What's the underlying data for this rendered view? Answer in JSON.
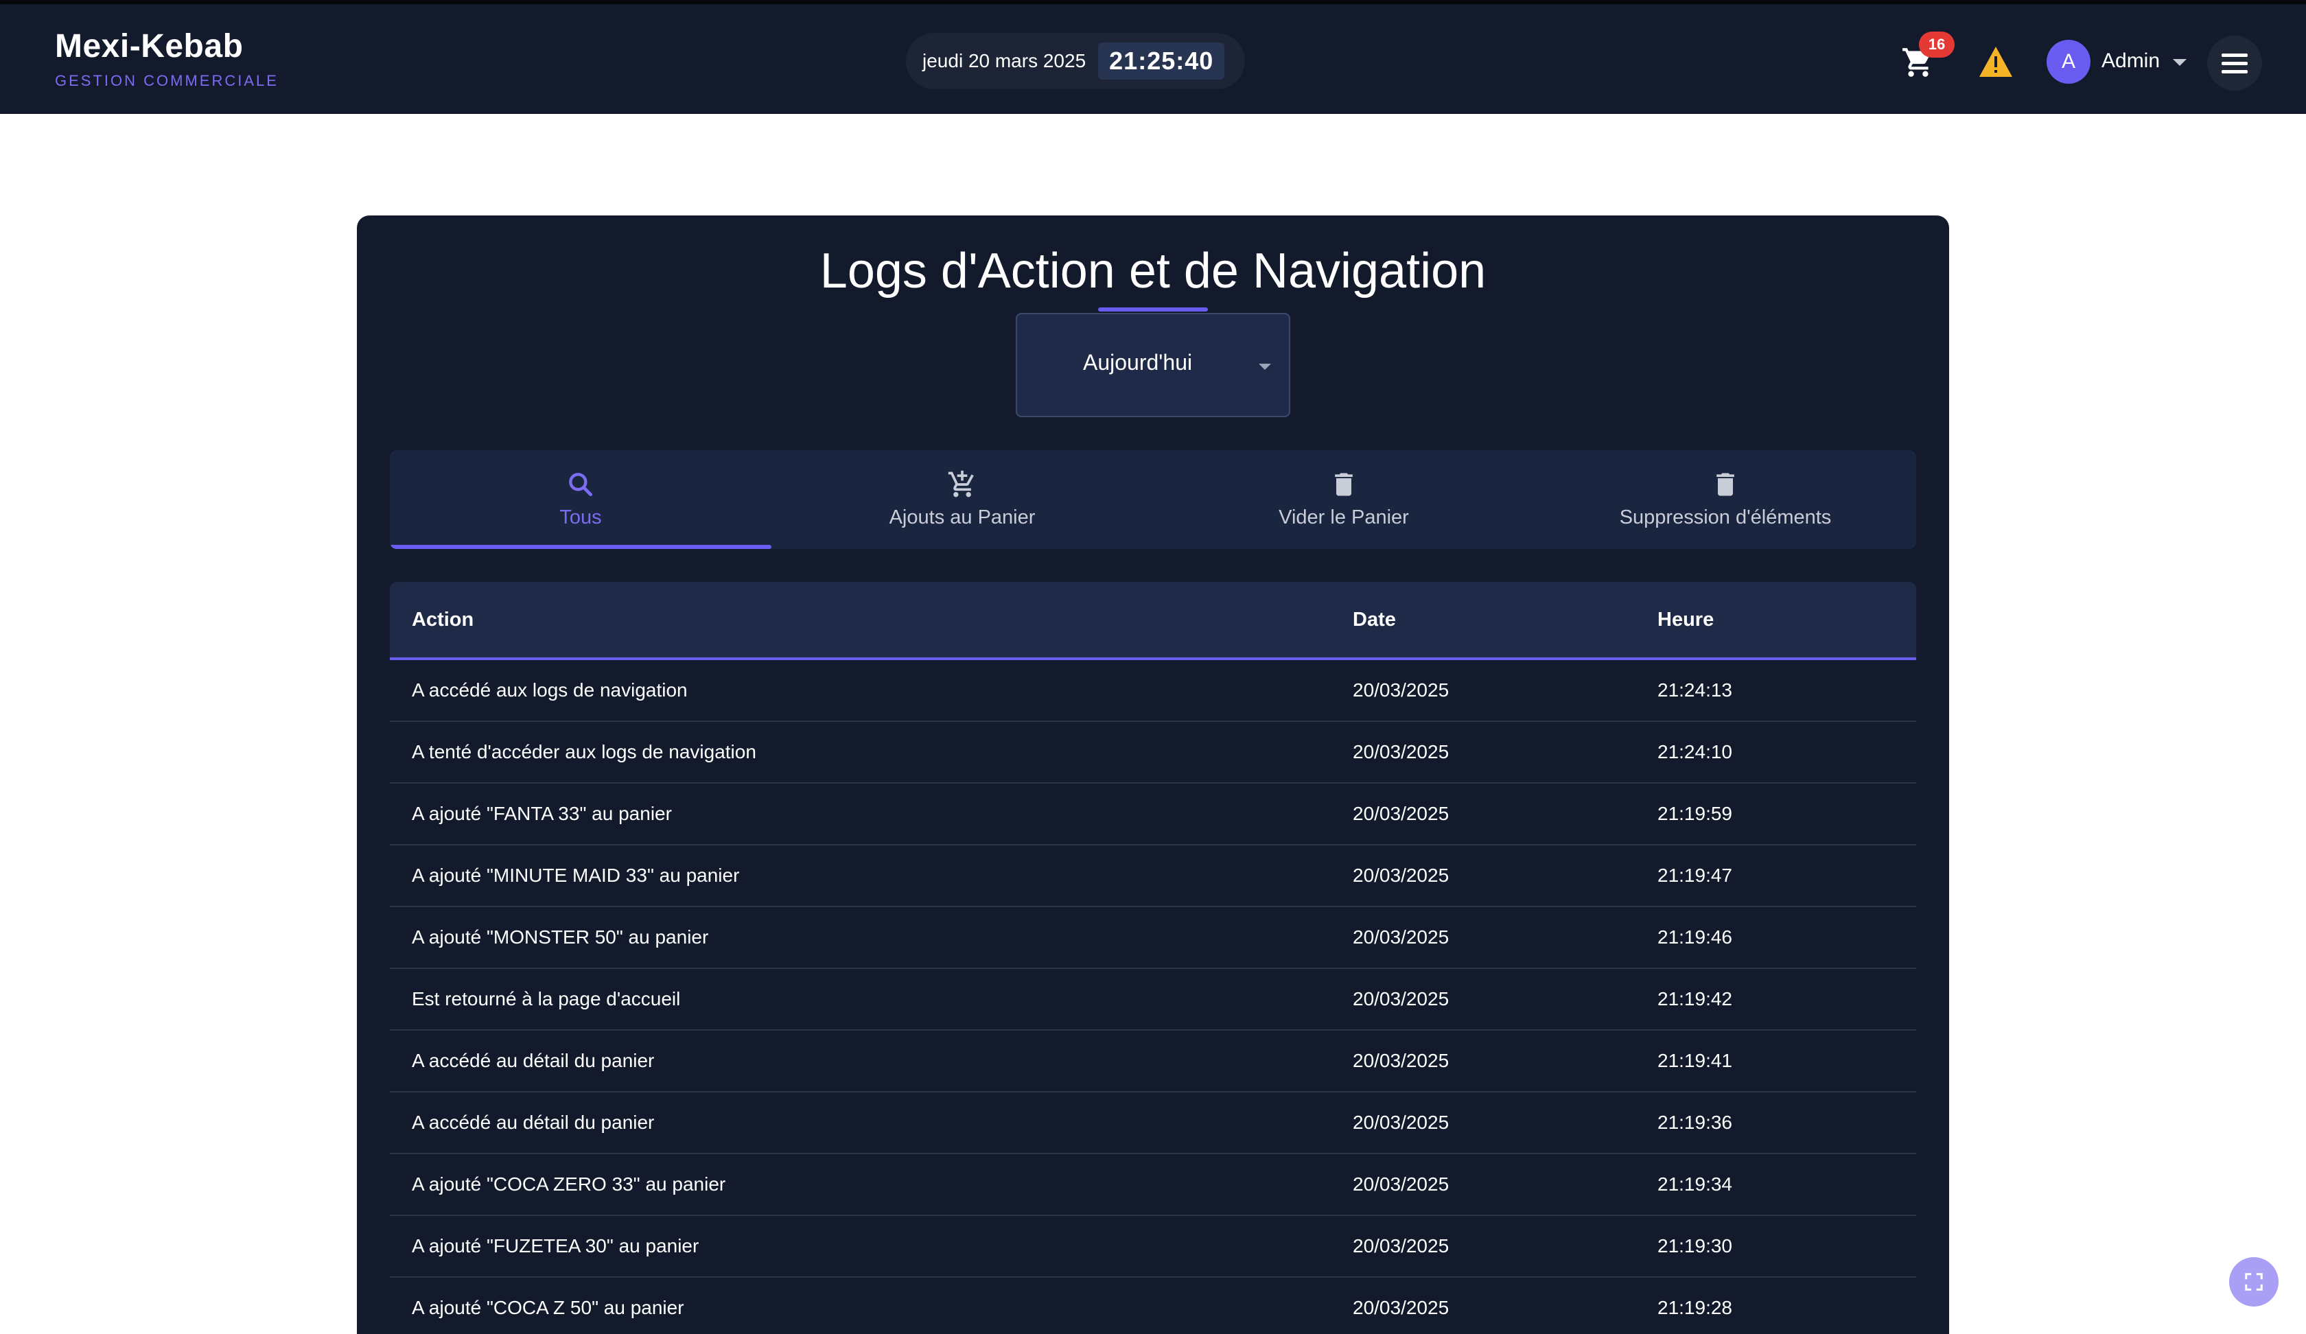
{
  "brand": {
    "name": "Mexi-Kebab",
    "subtitle": "GESTION COMMERCIALE"
  },
  "clock": {
    "date": "jeudi 20 mars 2025",
    "time": "21:25:40"
  },
  "cart": {
    "count": "16",
    "icon": "cart-icon"
  },
  "alert": {
    "icon": "warning-icon",
    "color": "#f5b428"
  },
  "user": {
    "initial": "A",
    "name": "Admin"
  },
  "page": {
    "title": "Logs d'Action et de Navigation",
    "period": {
      "selected": "Aujourd'hui"
    }
  },
  "tabs": [
    {
      "label": "Tous",
      "icon": "search-icon",
      "active": true
    },
    {
      "label": "Ajouts au Panier",
      "icon": "cart-add-icon",
      "active": false
    },
    {
      "label": "Vider le Panier",
      "icon": "trash-icon",
      "active": false
    },
    {
      "label": "Suppression d'éléments",
      "icon": "trash-icon",
      "active": false
    }
  ],
  "table": {
    "headers": {
      "action": "Action",
      "date": "Date",
      "time": "Heure"
    },
    "rows": [
      {
        "action": "A accédé aux logs de navigation",
        "date": "20/03/2025",
        "time": "21:24:13"
      },
      {
        "action": "A tenté d'accéder aux logs de navigation",
        "date": "20/03/2025",
        "time": "21:24:10"
      },
      {
        "action": "A ajouté \"FANTA 33\" au panier",
        "date": "20/03/2025",
        "time": "21:19:59"
      },
      {
        "action": "A ajouté \"MINUTE MAID 33\" au panier",
        "date": "20/03/2025",
        "time": "21:19:47"
      },
      {
        "action": "A ajouté \"MONSTER 50\" au panier",
        "date": "20/03/2025",
        "time": "21:19:46"
      },
      {
        "action": "Est retourné à la page d'accueil",
        "date": "20/03/2025",
        "time": "21:19:42"
      },
      {
        "action": "A accédé au détail du panier",
        "date": "20/03/2025",
        "time": "21:19:41"
      },
      {
        "action": "A accédé au détail du panier",
        "date": "20/03/2025",
        "time": "21:19:36"
      },
      {
        "action": "A ajouté \"COCA ZERO 33\" au panier",
        "date": "20/03/2025",
        "time": "21:19:34"
      },
      {
        "action": "A ajouté \"FUZETEA 30\" au panier",
        "date": "20/03/2025",
        "time": "21:19:30"
      },
      {
        "action": "A ajouté \"COCA Z 50\" au panier",
        "date": "20/03/2025",
        "time": "21:19:28"
      }
    ]
  },
  "colors": {
    "header_bg": "#121a2b",
    "accent": "#6a5cf0",
    "badge": "#e53935"
  }
}
